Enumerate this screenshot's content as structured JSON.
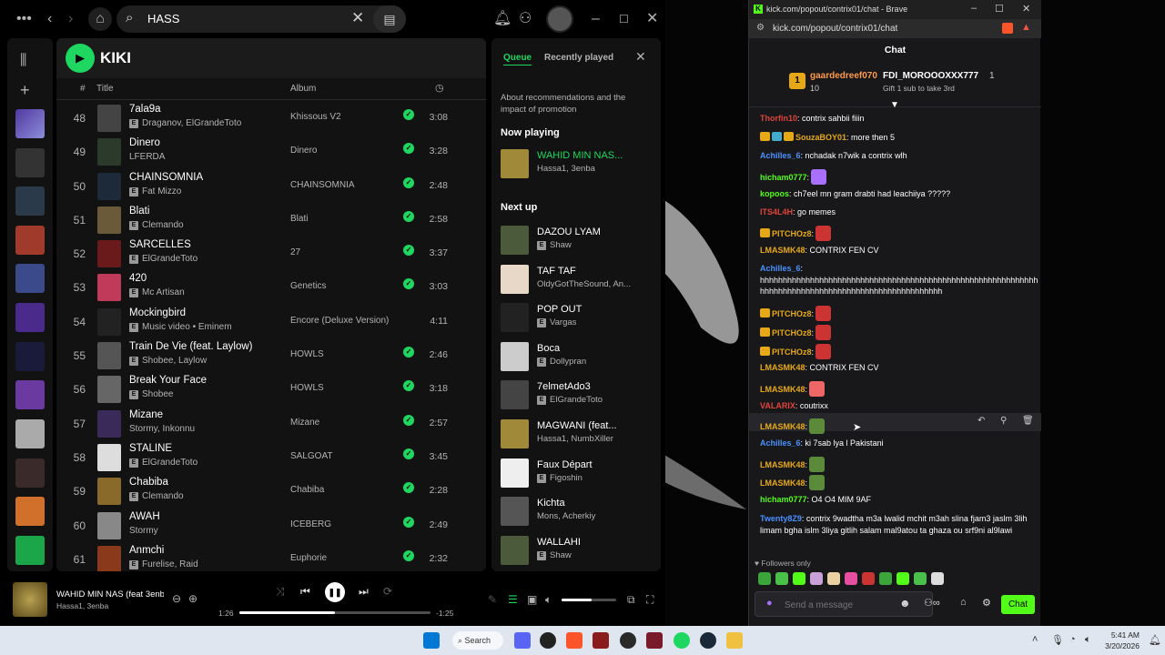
{
  "spotify": {
    "search_value": "HASS",
    "playlist_title": "KIKI",
    "columns": {
      "num": "#",
      "title": "Title",
      "album": "Album"
    },
    "tracks": [
      {
        "n": "48",
        "title": "7ala9a",
        "artist": "Draganov, ElGrandeToto",
        "album": "Khissous V2",
        "saved": true,
        "dur": "3:08",
        "explicit": true,
        "color": "#444"
      },
      {
        "n": "49",
        "title": "Dinero",
        "artist": "LFERDA",
        "album": "Dinero",
        "saved": true,
        "dur": "3:28",
        "explicit": false,
        "color": "#2b3a2b"
      },
      {
        "n": "50",
        "title": "CHAINSOMNIA",
        "artist": "Fat Mizzo",
        "album": "CHAINSOMNIA",
        "saved": true,
        "dur": "2:48",
        "explicit": true,
        "color": "#1c2a3a"
      },
      {
        "n": "51",
        "title": "Blati",
        "artist": "Clemando",
        "album": "Blati",
        "saved": true,
        "dur": "2:58",
        "explicit": true,
        "color": "#6a5a3a"
      },
      {
        "n": "52",
        "title": "SARCELLES",
        "artist": "ElGrandeToto",
        "album": "27",
        "saved": true,
        "dur": "3:37",
        "explicit": true,
        "color": "#6a1a1a"
      },
      {
        "n": "53",
        "title": "420",
        "artist": "Mc Artisan",
        "album": "Genetics",
        "saved": true,
        "dur": "3:03",
        "explicit": true,
        "color": "#c23a5a"
      },
      {
        "n": "54",
        "title": "Mockingbird",
        "artist": "Music video • Eminem",
        "album": "Encore (Deluxe Version)",
        "saved": false,
        "dur": "4:11",
        "explicit": true,
        "color": "#222"
      },
      {
        "n": "55",
        "title": "Train De Vie (feat. Laylow)",
        "artist": "Shobee, Laylow",
        "album": "HOWLS",
        "saved": true,
        "dur": "2:46",
        "explicit": true,
        "color": "#555"
      },
      {
        "n": "56",
        "title": "Break Your Face",
        "artist": "Shobee",
        "album": "HOWLS",
        "saved": true,
        "dur": "3:18",
        "explicit": true,
        "color": "#666"
      },
      {
        "n": "57",
        "title": "Mizane",
        "artist": "Stormy, Inkonnu",
        "album": "Mizane",
        "saved": true,
        "dur": "2:57",
        "explicit": false,
        "color": "#3a2a5a"
      },
      {
        "n": "58",
        "title": "STALINE",
        "artist": "ElGrandeToto",
        "album": "SALGOAT",
        "saved": true,
        "dur": "3:45",
        "explicit": true,
        "color": "#ddd"
      },
      {
        "n": "59",
        "title": "Chabiba",
        "artist": "Clemando",
        "album": "Chabiba",
        "saved": true,
        "dur": "2:28",
        "explicit": true,
        "color": "#8a6a2a"
      },
      {
        "n": "60",
        "title": "AWAH",
        "artist": "Stormy",
        "album": "ICEBERG",
        "saved": true,
        "dur": "2:49",
        "explicit": false,
        "color": "#888"
      },
      {
        "n": "61",
        "title": "Anmchi",
        "artist": "Furelise, Raid",
        "album": "Euphorie",
        "saved": true,
        "dur": "2:32",
        "explicit": true,
        "color": "#8a3a1a"
      }
    ],
    "queue": {
      "tab_queue": "Queue",
      "tab_recent": "Recently played",
      "about": "About recommendations and the impact of promotion",
      "now_playing_label": "Now playing",
      "now_playing": {
        "title": "WAHID MIN NAS...",
        "artist": "Hassa1, 3enba",
        "color": "#a08a3a"
      },
      "next_up_label": "Next up",
      "next": [
        {
          "title": "DAZOU LYAM",
          "artist": "Shaw",
          "explicit": true,
          "color": "#4a5a3a"
        },
        {
          "title": "TAF TAF",
          "artist": "OldyGotTheSound, An...",
          "explicit": false,
          "color": "#e8d8c8"
        },
        {
          "title": "POP OUT",
          "artist": "Vargas",
          "explicit": true,
          "color": "#222"
        },
        {
          "title": "Boca",
          "artist": "Dollypran",
          "explicit": true,
          "color": "#ccc"
        },
        {
          "title": "7elmetAdo3",
          "artist": "ElGrandeToto",
          "explicit": true,
          "color": "#444"
        },
        {
          "title": "MAGWANI (feat...",
          "artist": "Hassa1, NumbXiller",
          "explicit": false,
          "color": "#a08a3a"
        },
        {
          "title": "Faux Départ",
          "artist": "Figoshin",
          "explicit": true,
          "color": "#eee"
        },
        {
          "title": "Kichta",
          "artist": "Mons, Acherkiy",
          "explicit": false,
          "color": "#555"
        },
        {
          "title": "WALLAHI",
          "artist": "Shaw",
          "explicit": true,
          "color": "#4a5a3a"
        }
      ]
    },
    "player": {
      "title": "WAHID MIN NAS (feat 3enb",
      "artist": "Hassa1, 3enba",
      "elapsed": "1:26",
      "remaining": "-1:25",
      "progress": 0.5,
      "volume": 0.55
    }
  },
  "brave": {
    "window_title": "kick.com/popout/contrix01/chat - Brave",
    "url": "kick.com/popout/contrix01/chat",
    "chat_header": "Chat",
    "pinned": {
      "badge": "1",
      "user1": "gaardedreef070",
      "count1": "10",
      "user2": "FDI_MOROOOXXX777",
      "count2": "1",
      "gift_text": "Gift 1 sub to take 3rd"
    },
    "messages": [
      {
        "user": "Thorfin10",
        "color": "#e0443a",
        "text": ": contrix sahbii fiiin"
      },
      {
        "user": "SouzaBOY01",
        "color": "#e6a817",
        "text": ": more then 5",
        "badges": [
          "#e6a817",
          "#4ac",
          "#e6a817"
        ]
      },
      {
        "user": "Achilles_6",
        "color": "#4a90ff",
        "text": ": nchadak n7wik a contrix wlh"
      },
      {
        "user": "hicham0777",
        "color": "#53fc18",
        "text": ":",
        "emote": "#a970ff"
      },
      {
        "user": "kopoos",
        "color": "#53fc18",
        "text": ": ch7eel mn gram drabti had leachiiya ?????"
      },
      {
        "user": "ITS4L4H",
        "color": "#e0443a",
        "text": ": go memes"
      },
      {
        "user": "PITCHOz8",
        "color": "#e6a817",
        "text": ":",
        "emote": "#c33",
        "badges": [
          "#e6a817"
        ]
      },
      {
        "user": "LMASMK48",
        "color": "#e6a817",
        "text": ": CONTRIX FEN CV"
      },
      {
        "user": "Achilles_6",
        "color": "#4a90ff",
        "text": ": hhhhhhhhhhhhhhhhhhhhhhhhhhhhhhhhhhhhhhhhhhhhhhhhhhhhhhhhhhhhh hhhhhhhhhhhhhhhhhhhhhhhhhhhhhhhhhhhhhhhh"
      },
      {
        "user": "PITCHOz8",
        "color": "#e6a817",
        "text": ":",
        "emote": "#c33",
        "badges": [
          "#e6a817"
        ]
      },
      {
        "user": "PITCHOz8",
        "color": "#e6a817",
        "text": ":",
        "emote": "#c33",
        "badges": [
          "#e6a817"
        ]
      },
      {
        "user": "PITCHOz8",
        "color": "#e6a817",
        "text": ":",
        "emote": "#c33",
        "badges": [
          "#e6a817"
        ]
      },
      {
        "user": "LMASMK48",
        "color": "#e6a817",
        "text": ": CONTRIX FEN CV"
      },
      {
        "user": "LMASMK48",
        "color": "#e6a817",
        "text": ":",
        "emote": "#e66"
      },
      {
        "user": "VALARIX",
        "color": "#e0443a",
        "text": ": coutrixx"
      },
      {
        "user": "LMASMK48",
        "color": "#e6a817",
        "text": ":",
        "emote": "#5a8a3a"
      },
      {
        "user": "Achilles_6",
        "color": "#4a90ff",
        "text": ": ki 7sab lya l Pakistani"
      },
      {
        "user": "LMASMK48",
        "color": "#e6a817",
        "text": ":",
        "emote": "#5a8a3a"
      },
      {
        "user": "LMASMK48",
        "color": "#e6a817",
        "text": ":",
        "emote": "#5a8a3a"
      },
      {
        "user": "hicham0777",
        "color": "#53fc18",
        "text": ": O4 O4 MIM 9AF"
      },
      {
        "user": "Twenty8Z9",
        "color": "#4a90ff",
        "text": ": contrix 9wadtha m3a lwalid mchit m3ah slina fjam3 jaslm 3lih limam bgha islm 3liya gitlih salam mal9atou ta ghaza ou srf9ni al9lawi"
      }
    ],
    "followers_only": "Followers only",
    "input_placeholder": "Send a message",
    "chat_button": "Chat"
  },
  "taskbar": {
    "search_label": "Search",
    "time": "5:41 AM",
    "date": "3/20/2026"
  }
}
